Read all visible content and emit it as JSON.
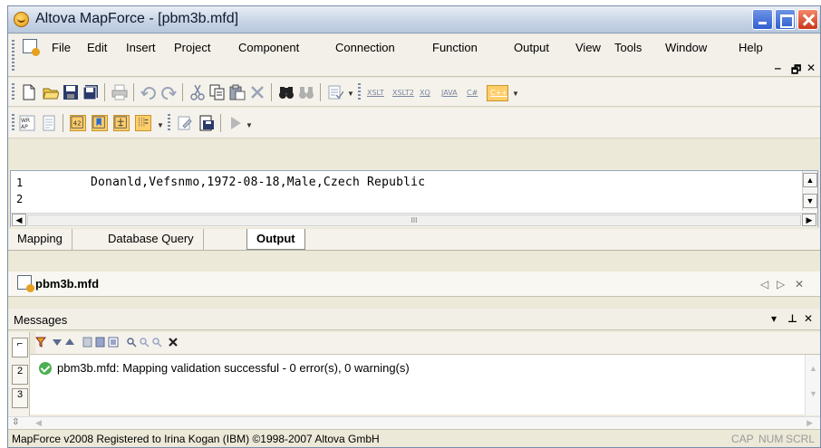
{
  "window": {
    "title": "Altova MapForce - [pbm3b.mfd]"
  },
  "menubar": {
    "items": [
      "File",
      "Edit",
      "Insert",
      "Project",
      "Component",
      "Connection",
      "Function",
      "Output",
      "View",
      "Tools",
      "Window",
      "Help"
    ]
  },
  "toolbar2": {
    "languages": [
      "XSLT",
      "XSLT2",
      "XQ",
      "JAVA",
      "C#",
      "C++"
    ],
    "selected_language": "C++"
  },
  "editor": {
    "line_numbers": [
      "1",
      "2"
    ],
    "lines": [
      "Donanld,Vefsnmo,1972-08-18,Male,Czech Republic",
      ""
    ],
    "hscroll_grip": "III"
  },
  "view_tabs": [
    "Mapping",
    "Database Query",
    "Output"
  ],
  "active_view_tab": "Output",
  "document_tab": {
    "title": "pbm3b.mfd"
  },
  "messages": {
    "title": "Messages",
    "side_tabs": [
      "2",
      "3"
    ],
    "entries": [
      "pbm3b.mfd: Mapping validation successful - 0 error(s), 0 warning(s)"
    ]
  },
  "statusbar": {
    "text": "MapForce v2008   Registered to Irina Kogan (IBM)   ©1998-2007 Altova GmbH",
    "indicators": [
      "CAP",
      "NUM",
      "SCRL"
    ]
  },
  "colors": {
    "highlight_button": "#ffce6a",
    "success": "#4caf50",
    "close_button": "#c8381a"
  }
}
